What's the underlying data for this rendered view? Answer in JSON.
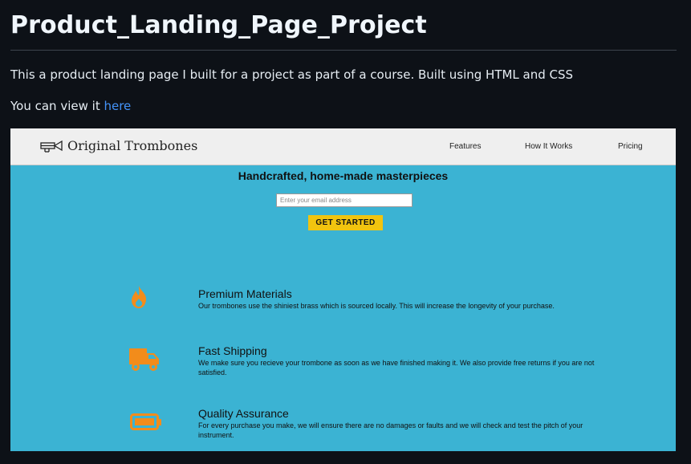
{
  "readme": {
    "title": "Product_Landing_Page_Project",
    "description": "This a product landing page I built for a project as part of a course. Built using HTML and CSS",
    "view_prefix": "You can view it ",
    "view_link": "here"
  },
  "preview": {
    "brand": "Original Trombones",
    "nav": [
      "Features",
      "How It Works",
      "Pricing"
    ],
    "hero_title": "Handcrafted, home-made masterpieces",
    "email_placeholder": "Enter your email address",
    "cta": "GET STARTED",
    "accent_color": "#f1c40f",
    "background_color": "#3bb3d3",
    "icon_color": "#f28c1b",
    "features": [
      {
        "icon": "fire-icon",
        "title": "Premium Materials",
        "desc": "Our trombones use the shiniest brass which is sourced locally. This will increase the longevity of your purchase."
      },
      {
        "icon": "truck-icon",
        "title": "Fast Shipping",
        "desc": "We make sure you recieve your trombone as soon as we have finished making it. We also provide free returns if you are not satisfied."
      },
      {
        "icon": "battery-icon",
        "title": "Quality Assurance",
        "desc": "For every purchase you make, we will ensure there are no damages or faults and we will check and test the pitch of your instrument."
      }
    ]
  }
}
